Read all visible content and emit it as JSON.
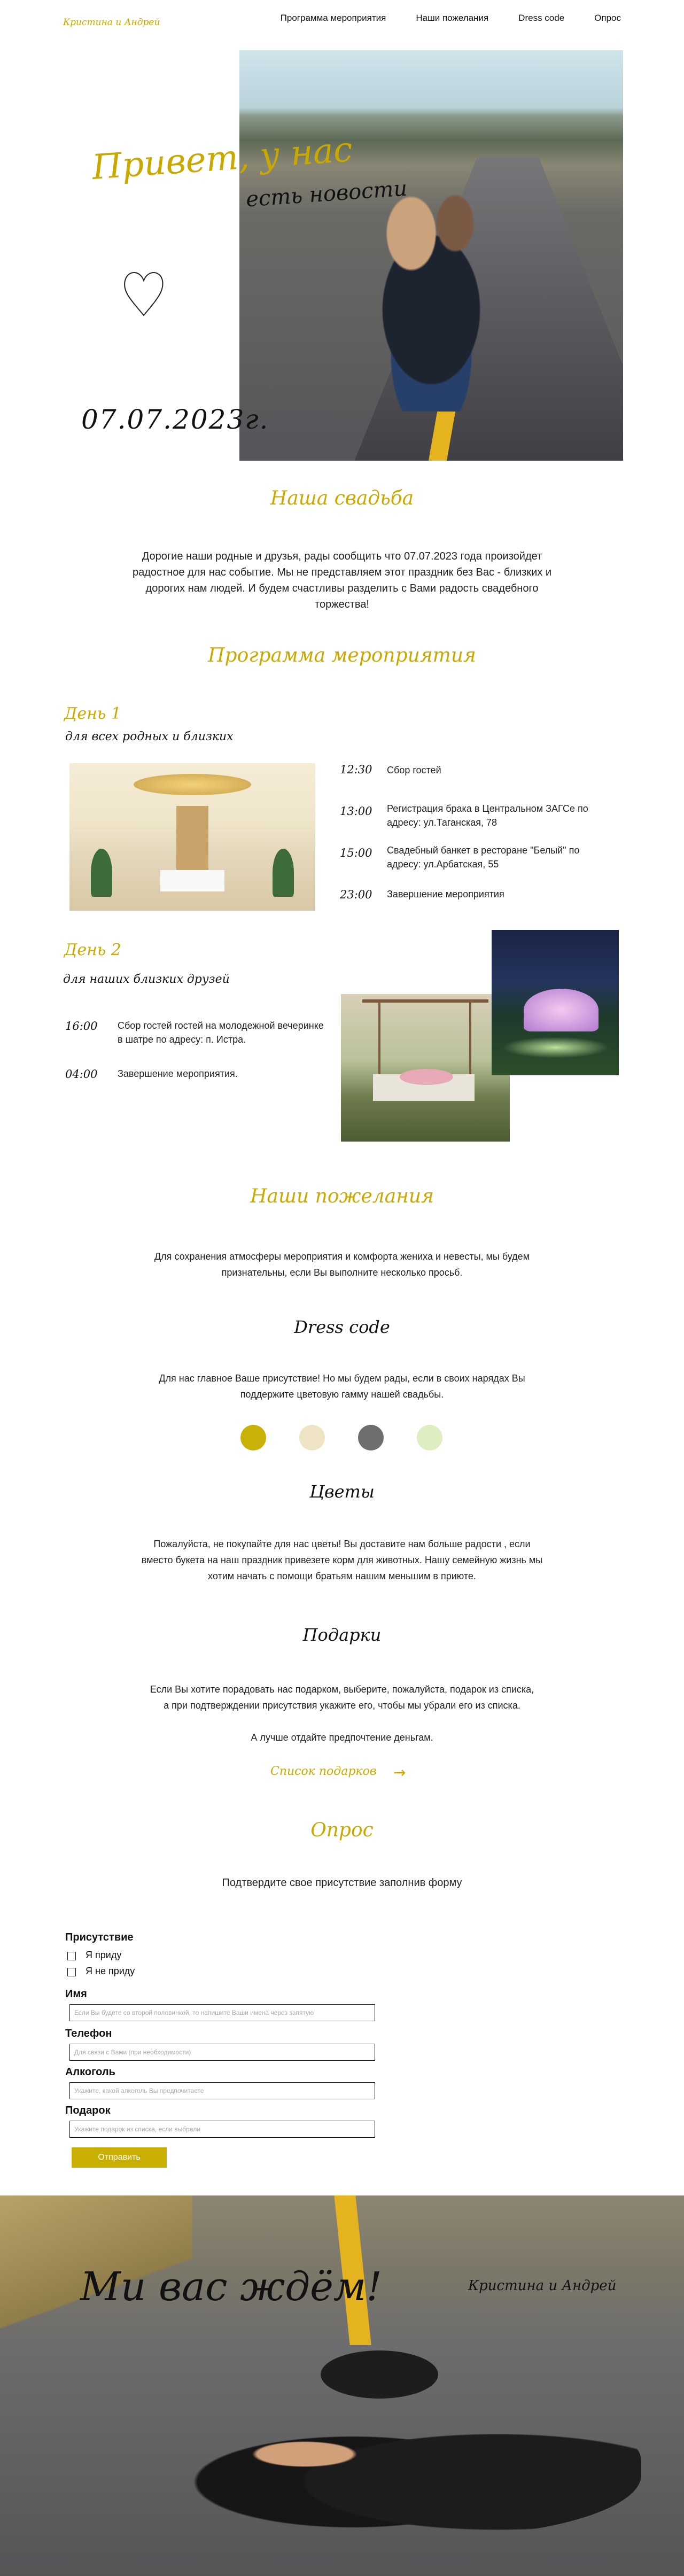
{
  "header": {
    "logo": "Кристина и Андрей",
    "nav": [
      "Программа мероприятия",
      "Наши пожелания",
      "Dress code",
      "Опрос"
    ]
  },
  "hero": {
    "title_line1": "Привет, у нас",
    "title_line2": "есть новости",
    "date": "07.07.2023г."
  },
  "story": {
    "title": "Наша свадьба",
    "text": "Дорогие наши родные и друзья, рады сообщить что 07.07.2023 года произойдет радостное для нас событие. Мы не представляем этот праздник без Вас - близких и дорогих нам людей. И будем счастливы разделить с Вами радость свадебного торжества!"
  },
  "program": {
    "title": "Программа мероприятия",
    "day1": {
      "label": "День 1",
      "sub": "для всех родных и близких",
      "schedule": [
        {
          "time": "12:30",
          "text": "Сбор гостей"
        },
        {
          "time": "13:00",
          "text": "Регистрация брака в Центральном ЗАГСе по адресу: ул.Таганская, 78"
        },
        {
          "time": "15:00",
          "text": "Свадебный банкет в ресторане \"Белый\" по адресу: ул.Арбатская, 55"
        },
        {
          "time": "23:00",
          "text": "Завершение мероприятия"
        }
      ]
    },
    "day2": {
      "label": "День 2",
      "sub": "для наших близких друзей",
      "schedule": [
        {
          "time": "16:00",
          "text": "Сбор гостей гостей на молодежной вечеринке в шатре по адресу: п. Истра."
        },
        {
          "time": "04:00",
          "text": "Завершение мероприятия."
        }
      ]
    }
  },
  "wishes": {
    "title": "Наши пожелания",
    "intro": "Для сохранения атмосферы мероприятия и комфорта жениха и невесты, мы будем признательны, если Вы выполните несколько просьб.",
    "dress": {
      "title": "Dress code",
      "text": "Для нас главное Ваше присутствие! Но мы будем рады, если в своих нарядах Вы поддержите цветовую гамму нашей свадьбы.",
      "colors": [
        "#c8b208",
        "#eee4c4",
        "#6e6e6e",
        "#deedc2"
      ]
    },
    "flowers": {
      "title": "Цветы",
      "text": "Пожалуйста, не покупайте для нас цветы! Вы доставите нам больше радости , если вместо букета на наш праздник привезете корм для животных. Нашу семейную жизнь мы хотим начать с помощи братьям нашим меньшим в приюте."
    },
    "gifts": {
      "title": "Подарки",
      "text1": "Если Вы хотите порадовать нас подарком, выберите, пожалуйста, подарок из списка, а при подтверждении присутствия укажите его, чтобы мы убрали его из списка.",
      "text2": "А лучше отдайте предпочтение деньгам.",
      "link": "Список подарков"
    }
  },
  "survey": {
    "title": "Опрос",
    "subtitle": "Подтвердите свое присутствие заполнив форму",
    "presence_label": "Присутствие",
    "opt_yes": "Я приду",
    "opt_no": "Я не приду",
    "name_label": "Имя",
    "name_placeholder": "Если Вы будете со второй половинкой, то напишите Ваши имена через запятую",
    "phone_label": "Телефон",
    "phone_placeholder": "Для связи с Вами (при необходимости)",
    "alcohol_label": "Алкоголь",
    "alcohol_placeholder": "Укажите, какой алкоголь Вы предпочитаете",
    "gift_label": "Подарок",
    "gift_placeholder": "Укажите подарок из списка, если выбрали",
    "submit": "Отправить"
  },
  "footer": {
    "title": "Ми вас ждём!",
    "names": "Кристина и Андрей"
  }
}
